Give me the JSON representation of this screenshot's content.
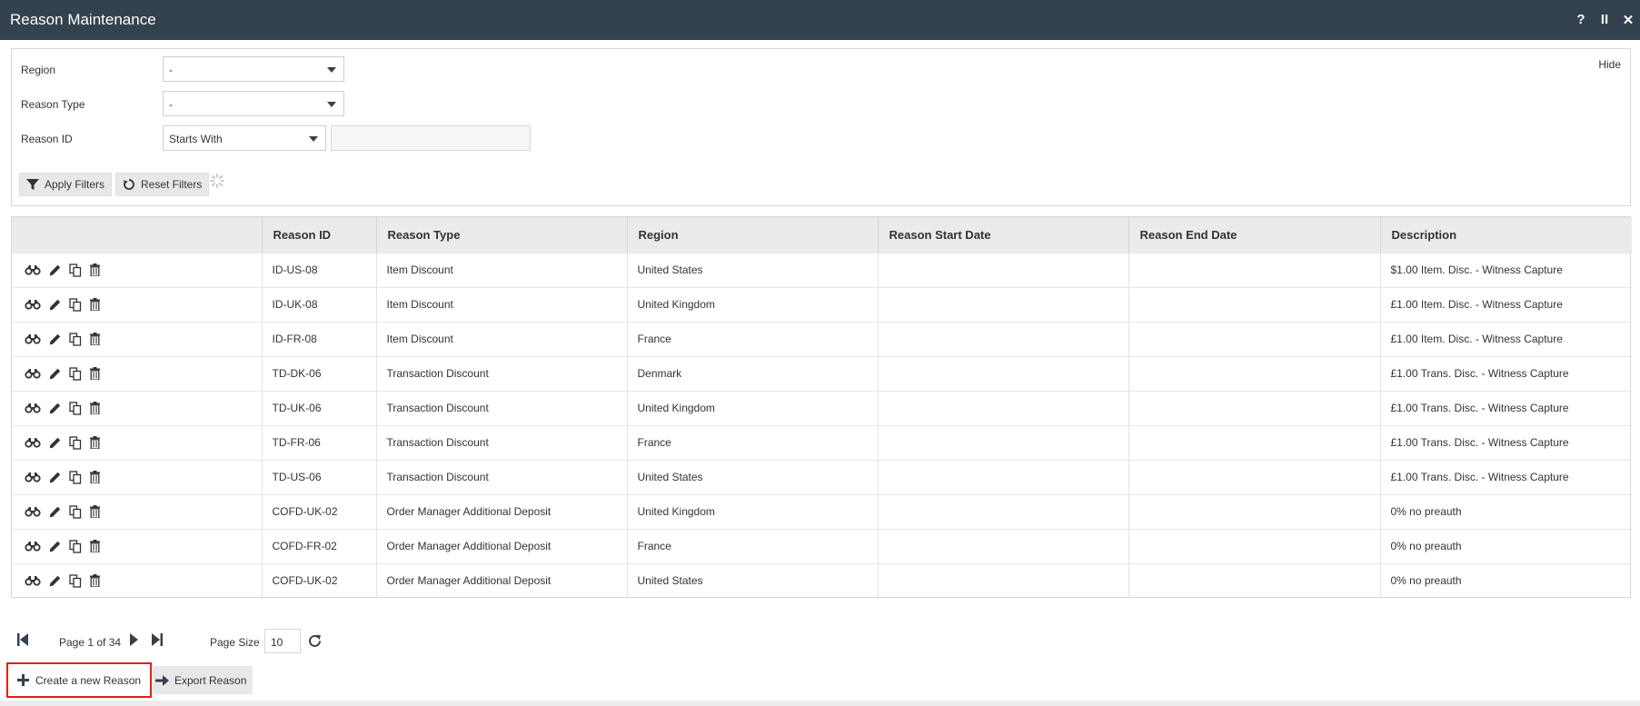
{
  "window": {
    "title": "Reason Maintenance",
    "help": "?",
    "pause": "II",
    "close": "✕"
  },
  "filters": {
    "hide_label": "Hide",
    "region": {
      "label": "Region",
      "value": "-"
    },
    "reason_type": {
      "label": "Reason Type",
      "value": "-"
    },
    "reason_id": {
      "label": "Reason ID",
      "operator": "Starts With",
      "value": ""
    },
    "apply_label": "Apply Filters",
    "reset_label": "Reset Filters"
  },
  "table": {
    "columns": [
      "",
      "Reason ID",
      "Reason Type",
      "Region",
      "Reason Start Date",
      "Reason End Date",
      "Description"
    ],
    "rows": [
      {
        "id": "ID-US-08",
        "type": "Item Discount",
        "region": "United States",
        "start": "",
        "end": "",
        "desc": "$1.00 Item. Disc. - Witness Capture"
      },
      {
        "id": "ID-UK-08",
        "type": "Item Discount",
        "region": "United Kingdom",
        "start": "",
        "end": "",
        "desc": "£1.00 Item. Disc. - Witness Capture"
      },
      {
        "id": "ID-FR-08",
        "type": "Item Discount",
        "region": "France",
        "start": "",
        "end": "",
        "desc": "£1.00 Item. Disc. - Witness Capture"
      },
      {
        "id": "TD-DK-06",
        "type": "Transaction Discount",
        "region": "Denmark",
        "start": "",
        "end": "",
        "desc": "£1.00 Trans. Disc. - Witness Capture"
      },
      {
        "id": "TD-UK-06",
        "type": "Transaction Discount",
        "region": "United Kingdom",
        "start": "",
        "end": "",
        "desc": "£1.00 Trans. Disc. - Witness Capture"
      },
      {
        "id": "TD-FR-06",
        "type": "Transaction Discount",
        "region": "France",
        "start": "",
        "end": "",
        "desc": "£1.00 Trans. Disc. - Witness Capture"
      },
      {
        "id": "TD-US-06",
        "type": "Transaction Discount",
        "region": "United States",
        "start": "",
        "end": "",
        "desc": "£1.00 Trans. Disc. - Witness Capture"
      },
      {
        "id": "COFD-UK-02",
        "type": "Order Manager Additional Deposit",
        "region": "United Kingdom",
        "start": "",
        "end": "",
        "desc": "0% no preauth"
      },
      {
        "id": "COFD-FR-02",
        "type": "Order Manager Additional Deposit",
        "region": "France",
        "start": "",
        "end": "",
        "desc": "0% no preauth"
      },
      {
        "id": "COFD-UK-02",
        "type": "Order Manager Additional Deposit",
        "region": "United States",
        "start": "",
        "end": "",
        "desc": "0% no preauth"
      }
    ],
    "row_actions": [
      "binoculars-icon",
      "pencil-icon",
      "copy-icon",
      "trash-icon"
    ]
  },
  "pager": {
    "page_text": "Page 1 of 34",
    "page_size_label": "Page Size",
    "page_size": "10"
  },
  "actions": {
    "create_label": "Create a new Reason",
    "export_label": "Export Reason"
  },
  "colors": {
    "titlebar": "#34414f",
    "highlight_border": "#e0201b",
    "button_bg": "#e8e8e8"
  }
}
